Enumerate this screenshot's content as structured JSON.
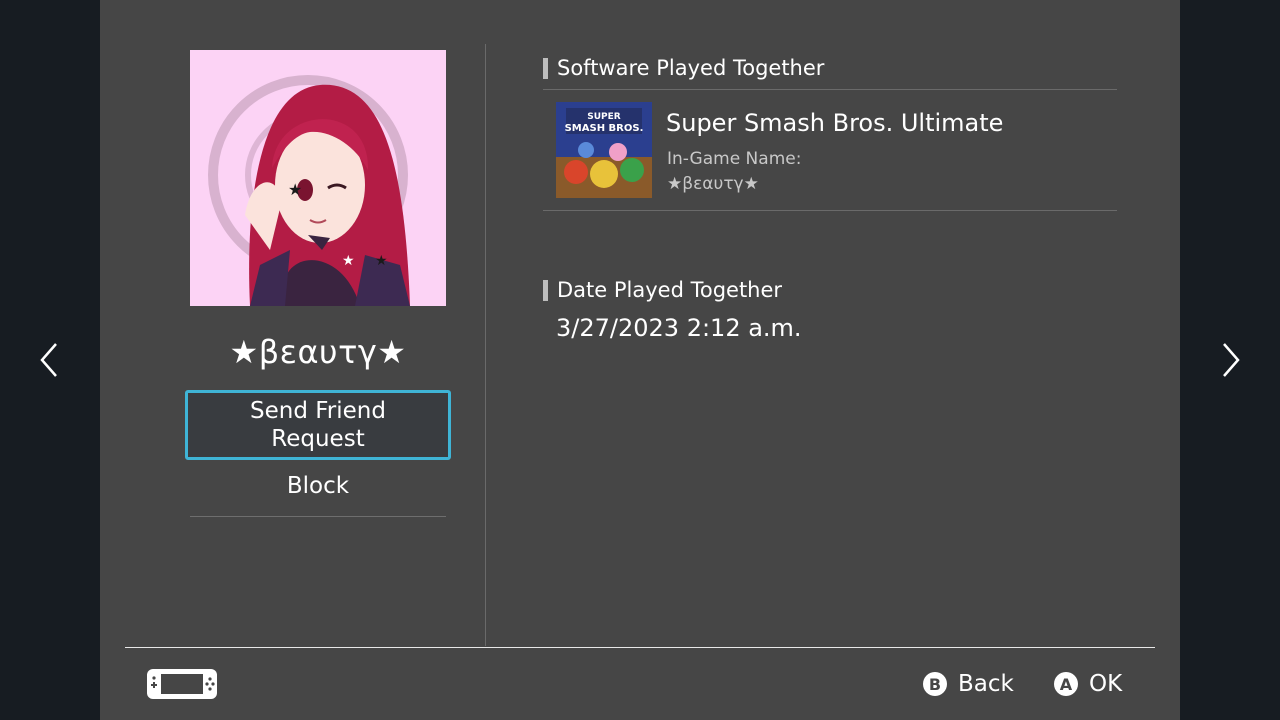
{
  "profile": {
    "name": "★βεαυτγ★",
    "actions": {
      "send_request_label": "Send Friend Request",
      "block_label": "Block"
    }
  },
  "software_section": {
    "heading": "Software Played Together",
    "game": {
      "title": "Super Smash Bros. Ultimate",
      "in_game_name_label": "In-Game Name:",
      "in_game_name_value": "★βεαυτγ★",
      "cover_logo_line1": "SUPER",
      "cover_logo_line2": "SMASH BROS."
    }
  },
  "date_section": {
    "heading": "Date Played Together",
    "value": "3/27/2023 2:12 a.m."
  },
  "footer": {
    "back_button": {
      "glyph": "B",
      "label": "Back"
    },
    "ok_button": {
      "glyph": "A",
      "label": "OK"
    }
  },
  "icons": {
    "nav_left": "chevron-left-icon",
    "nav_right": "chevron-right-icon",
    "console": "handheld-console-icon"
  },
  "colors": {
    "panel": "#464646",
    "focus_border": "#3fb4d6",
    "avatar_bg": "#fcd3f5",
    "background": "#16191f"
  }
}
